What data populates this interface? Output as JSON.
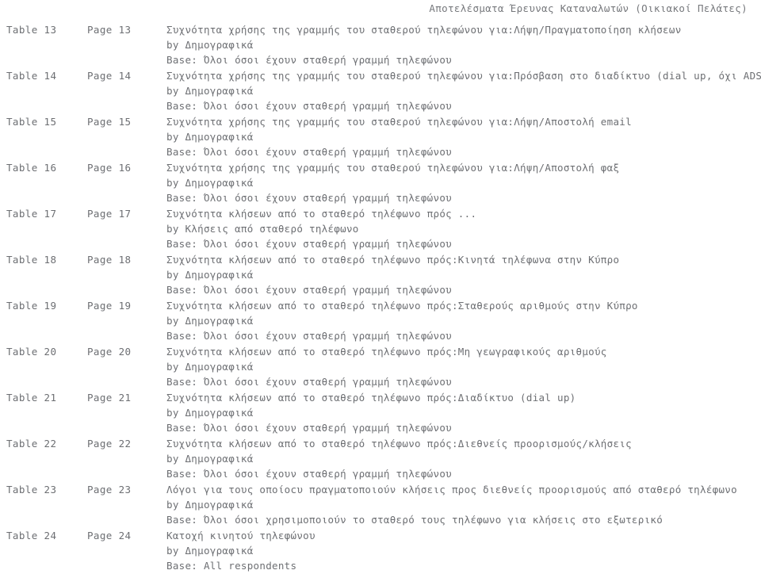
{
  "document": {
    "header_title": "Αποτελέσματα Έρευνας Καταναλωτών (Οικιακοί Πελάτες)",
    "text_color": "#6d6f73",
    "background_color": "#ffffff"
  },
  "toc": {
    "rows": [
      {
        "table_label": "Table 13",
        "page_label": "Page 13",
        "title": "Συχνότητα χρήσης της γραμμής του σταθερού τηλεφώνου για:Λήψη/Πραγματοποίηση κλήσεων",
        "by": "by Δημογραφικά",
        "base": "Base: Όλοι όσοι έχουν σταθερή γραμμή τηλεφώνου"
      },
      {
        "table_label": "Table 14",
        "page_label": "Page 14",
        "title": "Συχνότητα χρήσης της γραμμής του σταθερού τηλεφώνου για:Πρόσβαση στο διαδίκτυο (dial up, όχι ADSL)",
        "by": "by Δημογραφικά",
        "base": "Base: Όλοι όσοι έχουν σταθερή γραμμή τηλεφώνου"
      },
      {
        "table_label": "Table 15",
        "page_label": "Page 15",
        "title": "Συχνότητα χρήσης της γραμμής του σταθερού τηλεφώνου για:Λήψη/Αποστολή email",
        "by": "by Δημογραφικά",
        "base": "Base: Όλοι όσοι έχουν σταθερή γραμμή τηλεφώνου"
      },
      {
        "table_label": "Table 16",
        "page_label": "Page 16",
        "title": "Συχνότητα χρήσης της γραμμής του σταθερού τηλεφώνου για:Λήψη/Αποστολή φαξ",
        "by": "by Δημογραφικά",
        "base": "Base: Όλοι όσοι έχουν σταθερή γραμμή τηλεφώνου"
      },
      {
        "table_label": "Table 17",
        "page_label": "Page 17",
        "title": "Συχνότητα κλήσεων από το σταθερό τηλέφωνο πρός ...",
        "by": "by Κλήσεις από σταθερό τηλέφωνο",
        "base": "Base: Όλοι όσοι έχουν σταθερή γραμμή τηλεφώνου"
      },
      {
        "table_label": "Table 18",
        "page_label": "Page 18",
        "title": "Συχνότητα κλήσεων από το σταθερό τηλέφωνο πρός:Κινητά τηλέφωνα στην Κύπρο",
        "by": "by Δημογραφικά",
        "base": "Base: Όλοι όσοι έχουν σταθερή γραμμή τηλεφώνου"
      },
      {
        "table_label": "Table 19",
        "page_label": "Page 19",
        "title": "Συχνότητα κλήσεων από το σταθερό τηλέφωνο πρός:Σταθερούς αριθμούς στην Κύπρο",
        "by": "by Δημογραφικά",
        "base": "Base: Όλοι όσοι έχουν σταθερή γραμμή τηλεφώνου"
      },
      {
        "table_label": "Table 20",
        "page_label": "Page 20",
        "title": "Συχνότητα κλήσεων από το σταθερό τηλέφωνο πρός:Μη γεωγραφικούς αριθμούς",
        "by": "by Δημογραφικά",
        "base": "Base: Όλοι όσοι έχουν σταθερή γραμμή τηλεφώνου"
      },
      {
        "table_label": "Table 21",
        "page_label": "Page 21",
        "title": "Συχνότητα κλήσεων από το σταθερό τηλέφωνο πρός:Διαδίκτυο (dial up)",
        "by": "by Δημογραφικά",
        "base": "Base: Όλοι όσοι έχουν σταθερή γραμμή τηλεφώνου"
      },
      {
        "table_label": "Table 22",
        "page_label": "Page 22",
        "title": "Συχνότητα κλήσεων από το σταθερό τηλέφωνο πρός:Διεθνείς προορισμούς/κλήσεις",
        "by": "by Δημογραφικά",
        "base": "Base: Όλοι όσοι έχουν σταθερή γραμμή τηλεφώνου"
      },
      {
        "table_label": "Table 23",
        "page_label": "Page 23",
        "title": "Λόγοι για τους οποίοcυ πραγματοποιούν κλήσεις προς διεθνείς προορισμούς από σταθερό τηλέφωνο",
        "by": "by Δημογραφικά",
        "base": "Base: Όλοι όσοι χρησιμοποιούν το σταθερό τους τηλέφωνο για κλήσεις στο εξωτερικό"
      },
      {
        "table_label": "Table 24",
        "page_label": "Page 24",
        "title": "Κατοχή κινητού τηλεφώνου",
        "by": "by Δημογραφικά",
        "base": "Base: All respondents"
      }
    ]
  }
}
